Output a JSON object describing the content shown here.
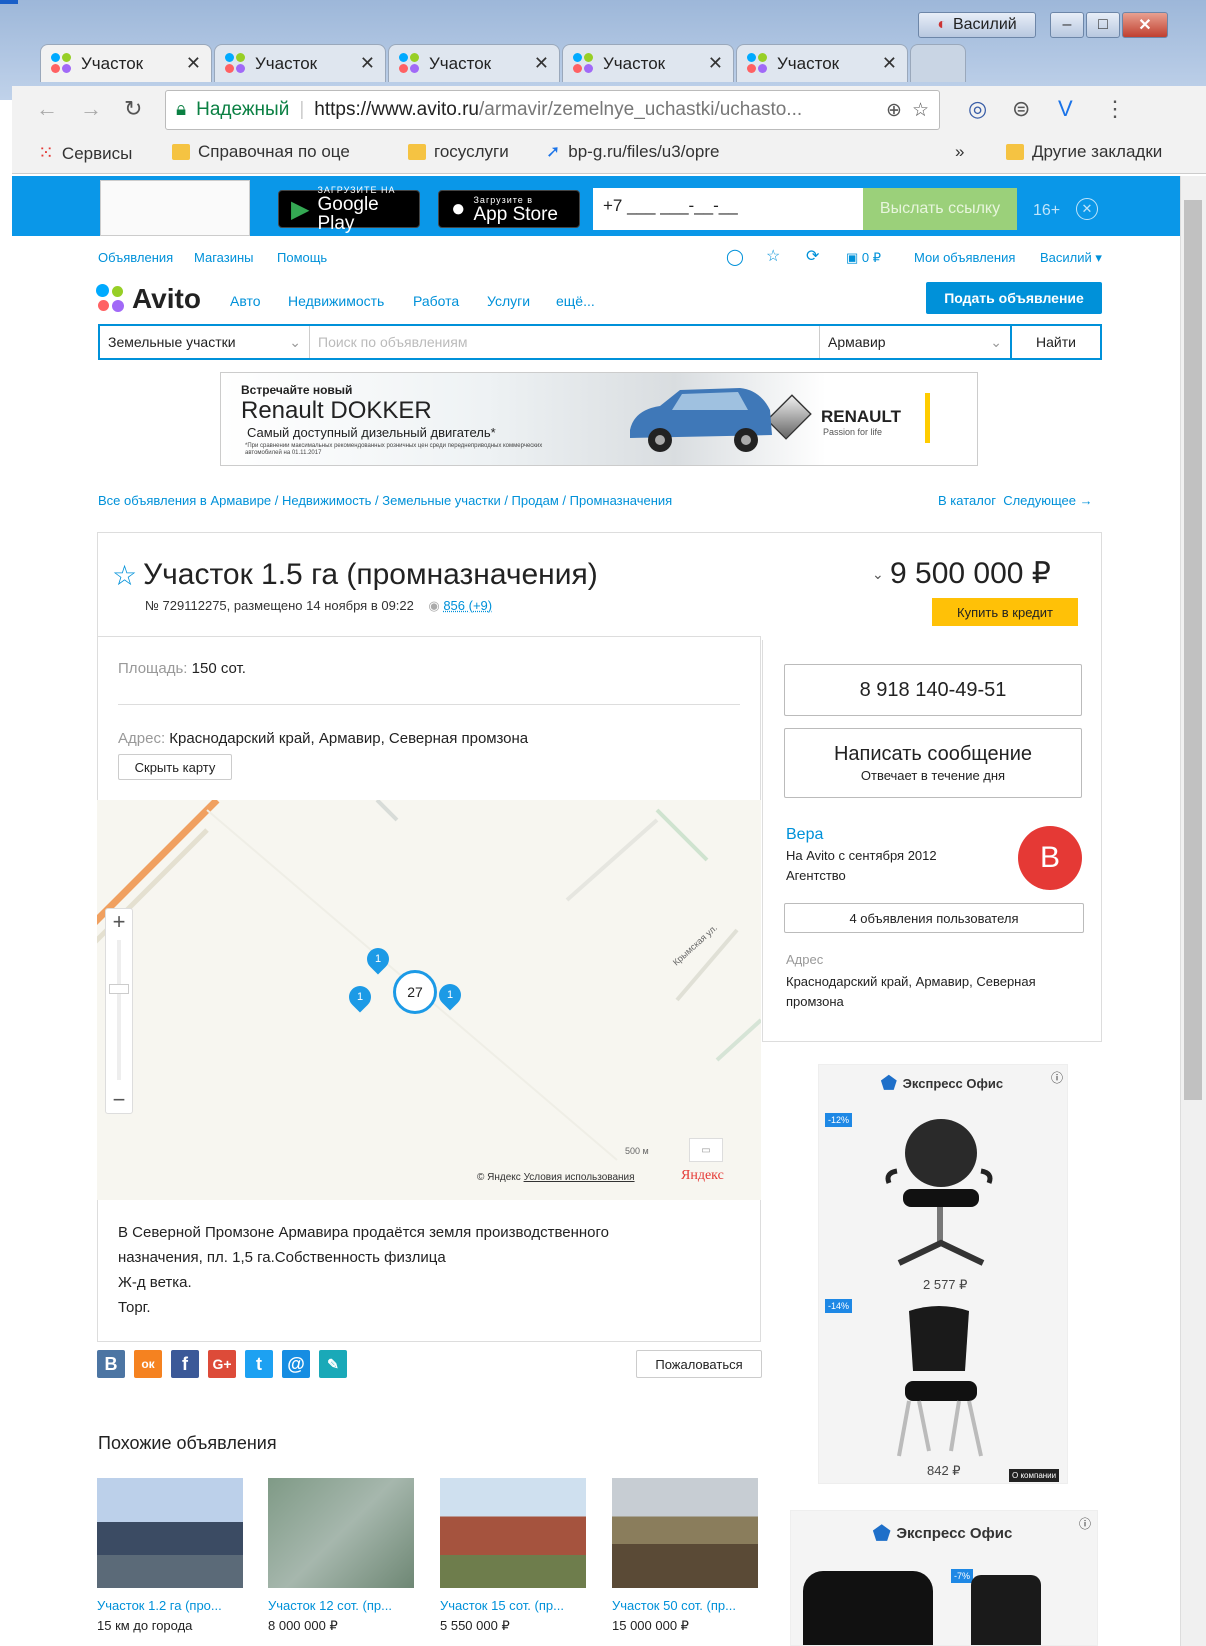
{
  "window": {
    "user": "Василий",
    "min": "–",
    "max": "□",
    "close": "✕"
  },
  "tabs": [
    {
      "label": "Участок"
    },
    {
      "label": "Участок"
    },
    {
      "label": "Участок"
    },
    {
      "label": "Участок"
    },
    {
      "label": "Участок"
    }
  ],
  "omnibox": {
    "secure": "Надежный",
    "url_host": "https://www.avito.ru",
    "url_path": "/armavir/zemelnye_uchastki/uchasto..."
  },
  "bookmarks": {
    "services": "Сервисы",
    "item1": "Справочная по оце",
    "item2": "госуслуги",
    "item3": "bp-g.ru/files/u3/opre",
    "more": "»",
    "other": "Другие закладки"
  },
  "app_banner": {
    "gp_small": "ЗАГРУЗИТЕ НА",
    "gp_big": "Google Play",
    "as_small": "Загрузите в",
    "as_big": "App Store",
    "phone_placeholder": "+7 ___ ___-__-__",
    "send": "Выслать ссылку",
    "age": "16+",
    "close": "✕"
  },
  "topnav": {
    "ads": "Объявления",
    "shops": "Магазины",
    "help": "Помощь",
    "wallet": "0 ₽",
    "my_ads": "Мои объявления",
    "user": "Василий ▾"
  },
  "logo": "Avito",
  "categories": {
    "auto": "Авто",
    "realty": "Недвижимость",
    "work": "Работа",
    "services": "Услуги",
    "more": "ещё..."
  },
  "post_button": "Подать объявление",
  "search": {
    "category": "Земельные участки",
    "placeholder": "Поиск по объявлениям",
    "city": "Армавир",
    "button": "Найти"
  },
  "ad_banner": {
    "line1": "Встречайте новый",
    "line2": "Renault DOKKER",
    "line3": "Самый доступный дизельный двигатель*",
    "fine": "*При сравнении максимальных рекомендованных розничных цен среди переднеприводных коммерческих автомобилей на 01.11.2017",
    "brand": "RENAULT",
    "slogan": "Passion for life"
  },
  "breadcrumb": "Все объявления в Армавире / Недвижимость / Земельные участки / Продам / Промназначения",
  "catalog_link": "В каталог",
  "next_link": "Следующее →",
  "listing": {
    "title": "Участок 1.5 га (промназначения)",
    "meta": "№ 729112275, размещено 14 ноября в 09:22",
    "views": "856 (+9)",
    "price": "9 500 000 ₽",
    "credit": "Купить в кредит",
    "area_label": "Площадь:",
    "area_value": "150 сот.",
    "address_label": "Адрес:",
    "address_value": "Краснодарский край, Армавир, Северная промзона",
    "hide_map": "Скрыть карту",
    "description": [
      "В Северной Промзоне Армавира продаётся земля производственного",
      "назначения, пл. 1,5 га.Собственность физлица",
      "Ж-д ветка.",
      "Торг."
    ],
    "complain": "Пожаловаться"
  },
  "map": {
    "street": "Крымская ул.",
    "cluster": "27",
    "pin": "1",
    "scale": "500 м",
    "copyright": "© Яндекс",
    "terms": "Условия использования",
    "brand": "Яндекс",
    "zoom_in": "+",
    "zoom_out": "−"
  },
  "share": [
    "В",
    "ок",
    "f",
    "G+",
    "t",
    "@",
    "✎"
  ],
  "seller": {
    "phone": "8 918 140-49-51",
    "message": "Написать сообщение",
    "replies": "Отвечает в течение дня",
    "name": "Вера",
    "since": "На Avito с сентября 2012",
    "type": "Агентство",
    "initial": "В",
    "user_ads": "4 объявления пользователя",
    "address_label": "Адрес",
    "address": "Краснодарский край, Армавир, Северная промзона"
  },
  "side_ads": {
    "brand": "Экспресс Офис",
    "d1": "-12%",
    "p1": "2 577 ₽",
    "d2": "-14%",
    "p2": "842 ₽",
    "d3": "-7%",
    "badge": "О компании"
  },
  "similar": {
    "title": "Похожие объявления",
    "items": [
      {
        "title": "Участок 1.2 га (про...",
        "sub": "15 км до города"
      },
      {
        "title": "Участок 12 сот. (пр...",
        "sub": "8 000 000 ₽"
      },
      {
        "title": "Участок 15 сот. (пр...",
        "sub": "5 550 000 ₽"
      },
      {
        "title": "Участок 50 сот. (пр...",
        "sub": "15 000 000 ₽"
      }
    ]
  }
}
